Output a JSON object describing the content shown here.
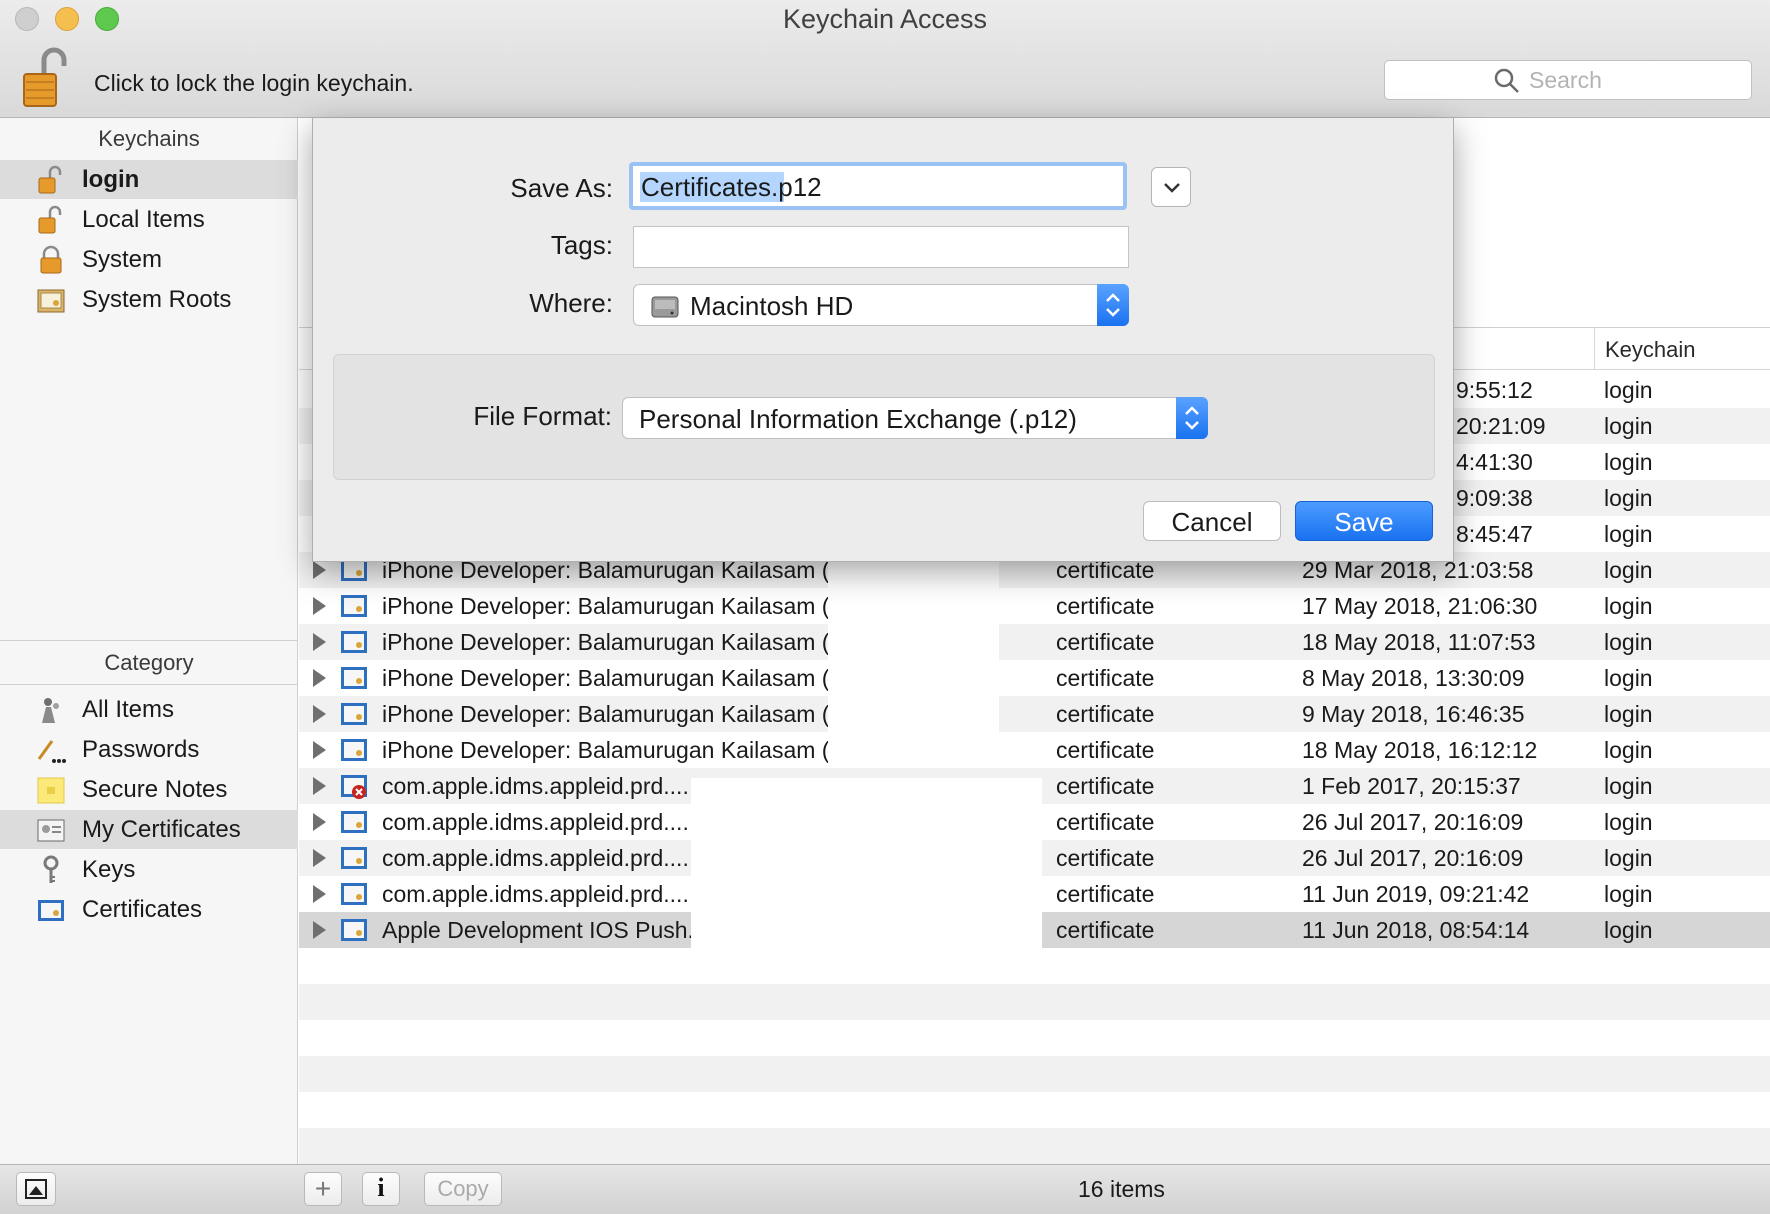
{
  "window": {
    "title": "Keychain Access"
  },
  "toolbar": {
    "lock_text": "Click to lock the login keychain.",
    "search_placeholder": "Search"
  },
  "sidebar": {
    "keychains_header": "Keychains",
    "keychains": [
      {
        "label": "login",
        "icon": "unlocked-padlock-icon",
        "selected": true
      },
      {
        "label": "Local Items",
        "icon": "unlocked-padlock-icon"
      },
      {
        "label": "System",
        "icon": "locked-padlock-icon"
      },
      {
        "label": "System Roots",
        "icon": "certificate-folder-icon"
      }
    ],
    "category_header": "Category",
    "categories": [
      {
        "label": "All Items",
        "icon": "people-icon"
      },
      {
        "label": "Passwords",
        "icon": "pen-dots-icon"
      },
      {
        "label": "Secure Notes",
        "icon": "note-icon"
      },
      {
        "label": "My Certificates",
        "icon": "id-certificate-icon",
        "selected": true
      },
      {
        "label": "Keys",
        "icon": "key-icon"
      },
      {
        "label": "Certificates",
        "icon": "certificate-icon"
      }
    ]
  },
  "table": {
    "columns": {
      "keychain": "Keychain"
    },
    "rows_partial": [
      {
        "date": "9:55:12",
        "keychain": "login"
      },
      {
        "date": "20:21:09",
        "keychain": "login"
      },
      {
        "date": "4:41:30",
        "keychain": "login"
      },
      {
        "date": "9:09:38",
        "keychain": "login"
      },
      {
        "date": "8:45:47",
        "keychain": "login"
      }
    ],
    "rows": [
      {
        "name": "iPhone Developer: Balamurugan Kailasam (",
        "kind": "certificate",
        "date": "29 Mar 2018, 21:03:58",
        "keychain": "login"
      },
      {
        "name": "iPhone Developer: Balamurugan Kailasam (",
        "kind": "certificate",
        "date": "17 May 2018, 21:06:30",
        "keychain": "login"
      },
      {
        "name": "iPhone Developer: Balamurugan Kailasam (",
        "kind": "certificate",
        "date": "18 May 2018, 11:07:53",
        "keychain": "login"
      },
      {
        "name": "iPhone Developer: Balamurugan Kailasam (",
        "kind": "certificate",
        "date": "8 May 2018, 13:30:09",
        "keychain": "login"
      },
      {
        "name": "iPhone Developer: Balamurugan Kailasam (",
        "kind": "certificate",
        "date": "9 May 2018, 16:46:35",
        "keychain": "login"
      },
      {
        "name": "iPhone Developer: Balamurugan Kailasam (",
        "kind": "certificate",
        "date": "18 May 2018, 16:12:12",
        "keychain": "login"
      },
      {
        "name": "com.apple.idms.appleid.prd....",
        "kind": "certificate",
        "date": "1 Feb 2017, 20:15:37",
        "keychain": "login",
        "invalid": true
      },
      {
        "name": "com.apple.idms.appleid.prd....",
        "kind": "certificate",
        "date": "26 Jul 2017, 20:16:09",
        "keychain": "login"
      },
      {
        "name": "com.apple.idms.appleid.prd....",
        "kind": "certificate",
        "date": "26 Jul 2017, 20:16:09",
        "keychain": "login"
      },
      {
        "name": "com.apple.idms.appleid.prd....",
        "kind": "certificate",
        "date": "11 Jun 2019, 09:21:42",
        "keychain": "login"
      },
      {
        "name": "Apple Development IOS Push...",
        "kind": "certificate",
        "date": "11 Jun 2018, 08:54:14",
        "keychain": "login",
        "selected": true
      }
    ]
  },
  "status": {
    "items_count": "16 items",
    "copy_label": "Copy",
    "add_label": "+",
    "info_label": "i"
  },
  "dialog": {
    "save_as_label": "Save As:",
    "save_as_value": "Certificates.p12",
    "tags_label": "Tags:",
    "where_label": "Where:",
    "where_value": "Macintosh HD",
    "file_format_label": "File Format:",
    "file_format_value": "Personal Information Exchange (.p12)",
    "cancel_label": "Cancel",
    "save_label": "Save"
  },
  "colors": {
    "accent": "#1a72f0",
    "selection": "#b4d5fe",
    "sidebar_selected": "#dcdcdc"
  }
}
